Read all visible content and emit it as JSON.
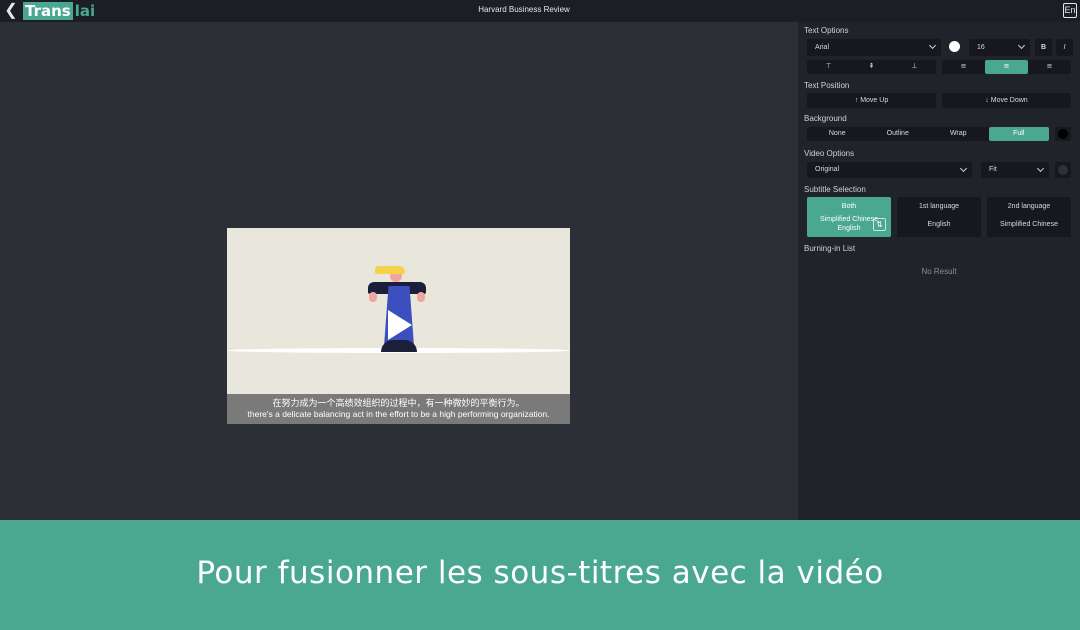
{
  "header": {
    "back_icon": "chevron-left-icon",
    "logo_a": "Trans",
    "logo_b": "lai",
    "title": "Harvard Business Review",
    "lang_button": "En"
  },
  "video": {
    "subtitle_zh": "在努力成为一个高绩效组织的过程中，有一种微妙的平衡行为。",
    "subtitle_en": "there's a delicate balancing act in the effort to be a high performing organization."
  },
  "text_options": {
    "title": "Text Options",
    "font": "Arial",
    "color": "#ffffff",
    "size": "16",
    "bold": "B",
    "italic": "I",
    "vertical_align": [
      "⊤",
      "⇞",
      "⊥"
    ],
    "horizontal_align": [
      "≡",
      "≡",
      "≡"
    ],
    "selected_horizontal": 1
  },
  "text_position": {
    "title": "Text Position",
    "up": "↑ Move Up",
    "down": "↓ Move Down"
  },
  "background": {
    "title": "Background",
    "options": [
      "None",
      "Outline",
      "Wrap",
      "Full"
    ],
    "selected": "Full",
    "color": "#000000"
  },
  "video_options": {
    "title": "Video Options",
    "ratio": "Original",
    "fit": "Fit"
  },
  "subtitle_selection": {
    "title": "Subtitle Selection",
    "both": {
      "label": "Both",
      "line1": "Simplified Chinese",
      "line2": "English"
    },
    "first": {
      "label": "1st language",
      "value": "English"
    },
    "second": {
      "label": "2nd language",
      "value": "Simplified Chinese"
    }
  },
  "burning_list": {
    "title": "Burning-in List",
    "empty": "No Result"
  },
  "banner": {
    "text": "Pour fusionner les sous-titres avec la vidéo"
  },
  "colors": {
    "accent": "#4aa891",
    "panel": "#202329",
    "canvas": "#2c2f36"
  }
}
